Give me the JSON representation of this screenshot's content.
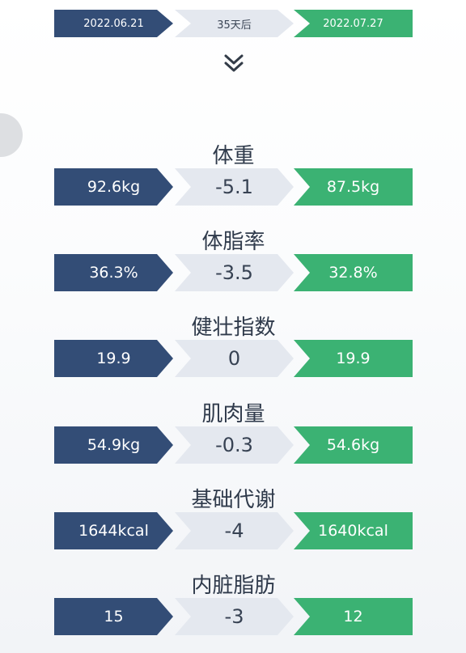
{
  "header": {
    "start_date": "2022.06.21",
    "duration": "35天后",
    "end_date": "2022.07.27"
  },
  "icons": {
    "expand": "double-chevron-down-icon"
  },
  "colors": {
    "before": "#334d76",
    "change": "#e4e8ef",
    "after": "#3bb273"
  },
  "metrics": [
    {
      "label": "体重",
      "before": "92.6kg",
      "change": "-5.1",
      "after": "87.5kg"
    },
    {
      "label": "体脂率",
      "before": "36.3%",
      "change": "-3.5",
      "after": "32.8%"
    },
    {
      "label": "健壮指数",
      "before": "19.9",
      "change": "0",
      "after": "19.9"
    },
    {
      "label": "肌肉量",
      "before": "54.9kg",
      "change": "-0.3",
      "after": "54.6kg"
    },
    {
      "label": "基础代谢",
      "before": "1644kcal",
      "change": "-4",
      "after": "1640kcal"
    },
    {
      "label": "内脏脂肪",
      "before": "15",
      "change": "-3",
      "after": "12"
    }
  ]
}
